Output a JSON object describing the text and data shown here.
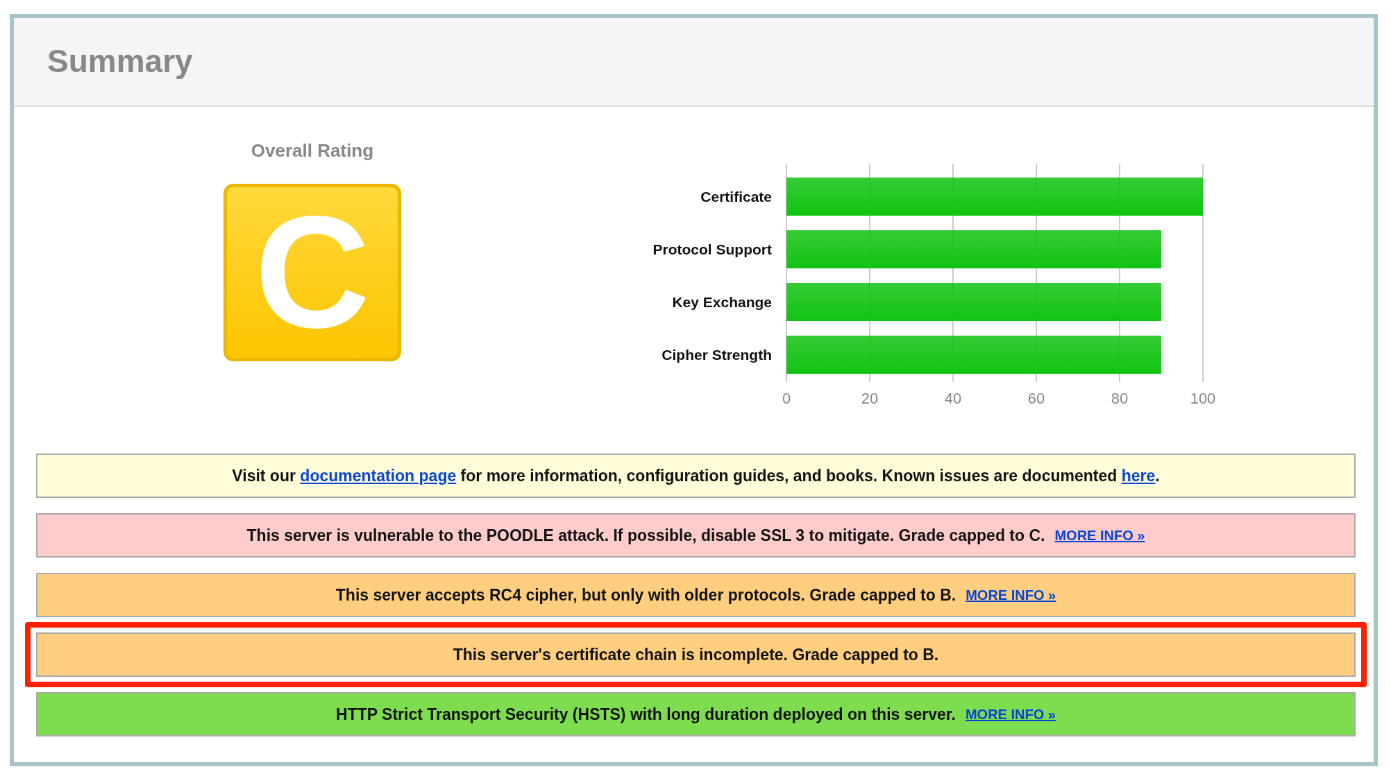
{
  "title": "Summary",
  "rating": {
    "label": "Overall Rating",
    "grade": "C"
  },
  "chart_data": {
    "type": "bar",
    "orientation": "horizontal",
    "categories": [
      "Certificate",
      "Protocol Support",
      "Key Exchange",
      "Cipher Strength"
    ],
    "series": [
      {
        "color": "#12c312",
        "values": [
          100,
          90,
          90,
          90
        ]
      }
    ],
    "xlim": [
      0,
      100
    ],
    "grid": true,
    "xticks": [
      0,
      20,
      40,
      60,
      80,
      100
    ]
  },
  "notices": [
    {
      "color": "#fffcd9",
      "highlighted": false,
      "parts": [
        {
          "text": "Visit our ",
          "link": false
        },
        {
          "text": "documentation page",
          "link": true
        },
        {
          "text": " for more information, configuration guides, and books. Known issues are documented ",
          "link": false
        },
        {
          "text": "here",
          "link": true
        },
        {
          "text": ".",
          "link": false
        }
      ]
    },
    {
      "color": "#ffcccc",
      "highlighted": false,
      "parts": [
        {
          "text": "This server is vulnerable to the POODLE attack. If possible, disable SSL 3 to mitigate. Grade capped to C.",
          "link": false
        }
      ],
      "more_info": "MORE INFO »"
    },
    {
      "color": "#ffcf7f",
      "highlighted": false,
      "parts": [
        {
          "text": "This server accepts RC4 cipher, but only with older protocols. Grade capped to B.",
          "link": false
        }
      ],
      "more_info": "MORE INFO »"
    },
    {
      "color": "#ffcf7f",
      "highlighted": true,
      "parts": [
        {
          "text": "This server's certificate chain is incomplete. Grade capped to B.",
          "link": false
        }
      ]
    },
    {
      "color": "#7edd4e",
      "highlighted": false,
      "parts": [
        {
          "text": "HTTP Strict Transport Security (HSTS) with long duration deployed on this server.",
          "link": false
        }
      ],
      "more_info": "MORE INFO »"
    }
  ]
}
